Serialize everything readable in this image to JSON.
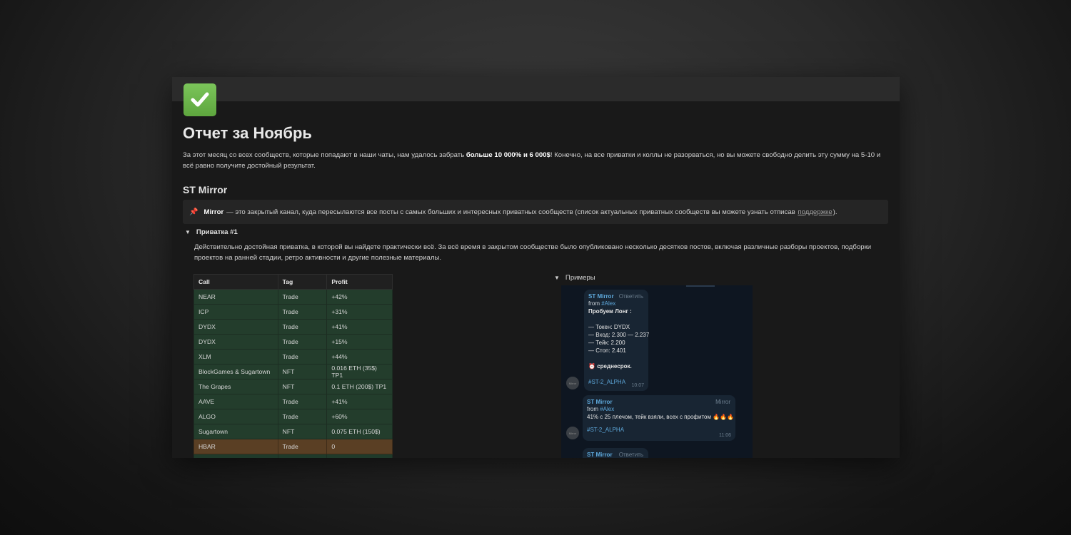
{
  "page": {
    "title": "Отчет за Ноябрь",
    "intro_pre": "За этот месяц со всех сообществ, которые попадают в наши чаты, нам удалось забрать ",
    "intro_bold": "больше 10 000% и 6 000$",
    "intro_post": "! Конечно, на все приватки и коллы не разорваться, но вы можете свободно делить эту сумму на 5-10 и всё равно получите достойный результат."
  },
  "section": {
    "title": "ST Mirror",
    "callout_bold": "Mirror",
    "callout_text": "— это закрытый канал, куда пересылаются все посты с самых больших и интересных приватных сообществ (список актуальных приватных сообществ вы можете узнать отписав",
    "callout_link": "поддержке",
    "callout_end": ")."
  },
  "toggle": {
    "title": "Приватка #1",
    "description": "Действительно достойная приватка, в которой вы найдете практически всё. За всё время в закрытом сообществе было опубликовано несколько десятков постов, включая различные разборы проектов, подборки проектов на ранней стадии, ретро активности и другие полезные материалы."
  },
  "table": {
    "headers": [
      "Call",
      "Tag",
      "Profit"
    ],
    "rows": [
      [
        "NEAR",
        "Trade",
        "+42%"
      ],
      [
        "ICP",
        "Trade",
        "+31%"
      ],
      [
        "DYDX",
        "Trade",
        "+41%"
      ],
      [
        "DYDX",
        "Trade",
        "+15%"
      ],
      [
        "XLM",
        "Trade",
        "+44%"
      ],
      [
        "BlockGames & Sugartown",
        "NFT",
        "0.016 ETH (35$) TP1"
      ],
      [
        "The Grapes",
        "NFT",
        "0.1 ETH (200$) TP1"
      ],
      [
        "AAVE",
        "Trade",
        "+41%"
      ],
      [
        "ALGO",
        "Trade",
        "+60%"
      ],
      [
        "Sugartown",
        "NFT",
        "0.075 ETH (150$)"
      ],
      [
        "HBAR",
        "Trade",
        "0"
      ]
    ]
  },
  "examples": {
    "title": "Примеры",
    "msg1": {
      "sender": "ST Mirror",
      "reply": "Ответить",
      "from_prefix": "from ",
      "from_account": "#Alex",
      "line_title": "Пробуем Лонг :",
      "token_label": "— Токен:",
      "token_value": "DYDX",
      "entry_label": "— Вход:",
      "entry_value": "2.300 — 2.237",
      "take_label": "— Тейк:",
      "take_value": "2.200",
      "stop_label": "— Стоп:",
      "stop_value": "2.401",
      "term": "среднесрок.",
      "hashtag": "#ST-2_ALPHA",
      "time": "10:07"
    },
    "msg2": {
      "sender": "ST Mirror",
      "badge": "Mirror",
      "from_prefix": "from ",
      "from_account": "#Alex",
      "text": "41% с 25 плечом, тейк взяли, всех с профитом",
      "hashtag": "#ST-2_ALPHA",
      "time": "11:06"
    },
    "msg3": {
      "sender": "ST Mirror",
      "reply": "Ответить"
    },
    "avatar_text": "Mirror"
  },
  "colors": {
    "accent_link": "#5ea9dc",
    "row_green": "#233d2c",
    "row_orange": "#5a3f24"
  },
  "icons": [
    "check-mark-icon",
    "pin-icon",
    "triangle-down-icon",
    "alarm-clock-icon",
    "fire-icon"
  ]
}
